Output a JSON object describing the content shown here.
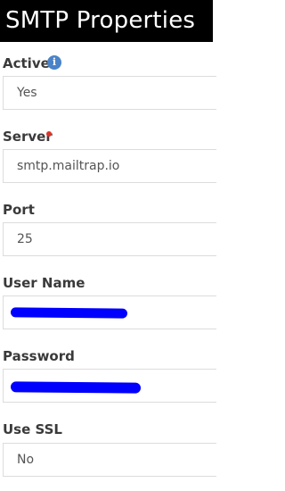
{
  "header": {
    "title": "SMTP Properties"
  },
  "fields": {
    "active": {
      "label": "Active",
      "value": "Yes",
      "info_icon": "info-icon"
    },
    "server": {
      "label": "Server",
      "value": "smtp.mailtrap.io",
      "required": true
    },
    "port": {
      "label": "Port",
      "value": "25"
    },
    "user_name": {
      "label": "User Name",
      "redacted": true
    },
    "password": {
      "label": "Password",
      "redacted": true
    },
    "use_ssl": {
      "label": "Use SSL",
      "value": "No"
    }
  },
  "colors": {
    "header_background": "#000000",
    "header_text": "#ffffff",
    "info_icon": "#4a83c8",
    "required_marker": "#d9342b",
    "redaction": "#0000ff"
  }
}
